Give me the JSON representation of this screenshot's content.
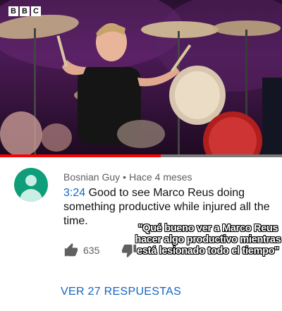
{
  "video": {
    "channel_logo": [
      "B",
      "B",
      "C"
    ],
    "progress_fraction": 0.57
  },
  "comment": {
    "author": "Bosnian Guy",
    "age": "Hace 4 meses",
    "timestamp": "3:24",
    "text": " Good to see Marco Reus doing something productive while injured all the time.",
    "likes": "635"
  },
  "caption": "\"Qué bueno ver a Marco Reus hacer algo productivo mientras está lesionado todo el tiempo\"",
  "replies_label": "VER 27 RESPUESTAS",
  "colors": {
    "accent_link": "#1565c0",
    "progress": "#ff0000",
    "avatar": "#0f9d7a"
  },
  "icons": [
    "user-avatar-icon",
    "thumbs-up-icon",
    "thumbs-down-icon"
  ]
}
